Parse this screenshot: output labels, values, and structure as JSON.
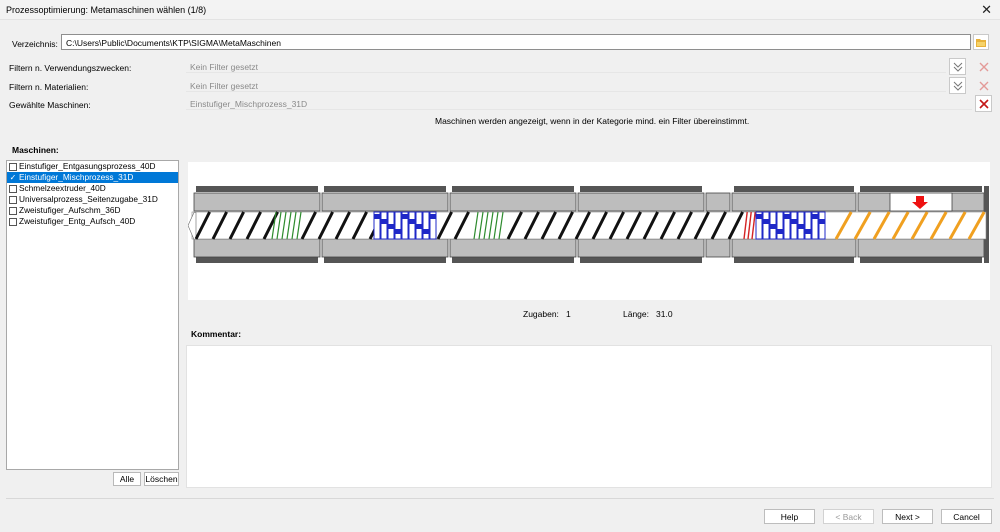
{
  "window": {
    "title": "Prozessoptimierung: Metamaschinen wählen (1/8)"
  },
  "form": {
    "directory_label": "Verzeichnis:",
    "directory_value": "C:\\Users\\Public\\Documents\\KTP\\SIGMA\\MetaMaschinen",
    "filter_purpose_label": "Filtern n. Verwendungszwecken:",
    "filter_purpose_value": "Kein Filter gesetzt",
    "filter_material_label": "Filtern n. Materialien:",
    "filter_material_value": "Kein Filter gesetzt",
    "selected_machines_label": "Gewählte Maschinen:",
    "selected_machines_value": "Einstufiger_Mischprozess_31D",
    "info_text": "Maschinen werden angezeigt, wenn in der Kategorie mind. ein Filter übereinstimmt."
  },
  "machines": {
    "heading": "Maschinen:",
    "items": [
      {
        "label": "Einstufiger_Entgasungsprozess_40D",
        "selected": false
      },
      {
        "label": "Einstufiger_Mischprozess_31D",
        "selected": true
      },
      {
        "label": "Schmelzeextruder_40D",
        "selected": false
      },
      {
        "label": "Universalprozess_Seitenzugabe_31D",
        "selected": false
      },
      {
        "label": "Zweistufiger_Aufschm_36D",
        "selected": false
      },
      {
        "label": "Zweistufiger_Entg_Aufsch_40D",
        "selected": false
      }
    ],
    "all_button": "Alle",
    "delete_button": "Löschen"
  },
  "stats": {
    "additions_label": "Zugaben:",
    "additions_value": "1",
    "length_label": "Länge:",
    "length_value": "31.0"
  },
  "comment": {
    "label": "Kommentar:",
    "value": ""
  },
  "buttons": {
    "help": "Help",
    "back": "< Back",
    "next": "Next >",
    "cancel": "Cancel"
  },
  "icons": {
    "close": "close-icon",
    "folder": "folder-icon",
    "filter": "chevron-double-down-icon",
    "clear": "x-icon",
    "feed": "arrow-down-icon"
  },
  "colors": {
    "accent": "#0078d7",
    "clear_red": "#d9534f",
    "kneading_blue": "#1f28c8",
    "mixing_green": "#2e8b2e",
    "reverse_red": "#d42424",
    "orange_screw": "#f0a020"
  }
}
